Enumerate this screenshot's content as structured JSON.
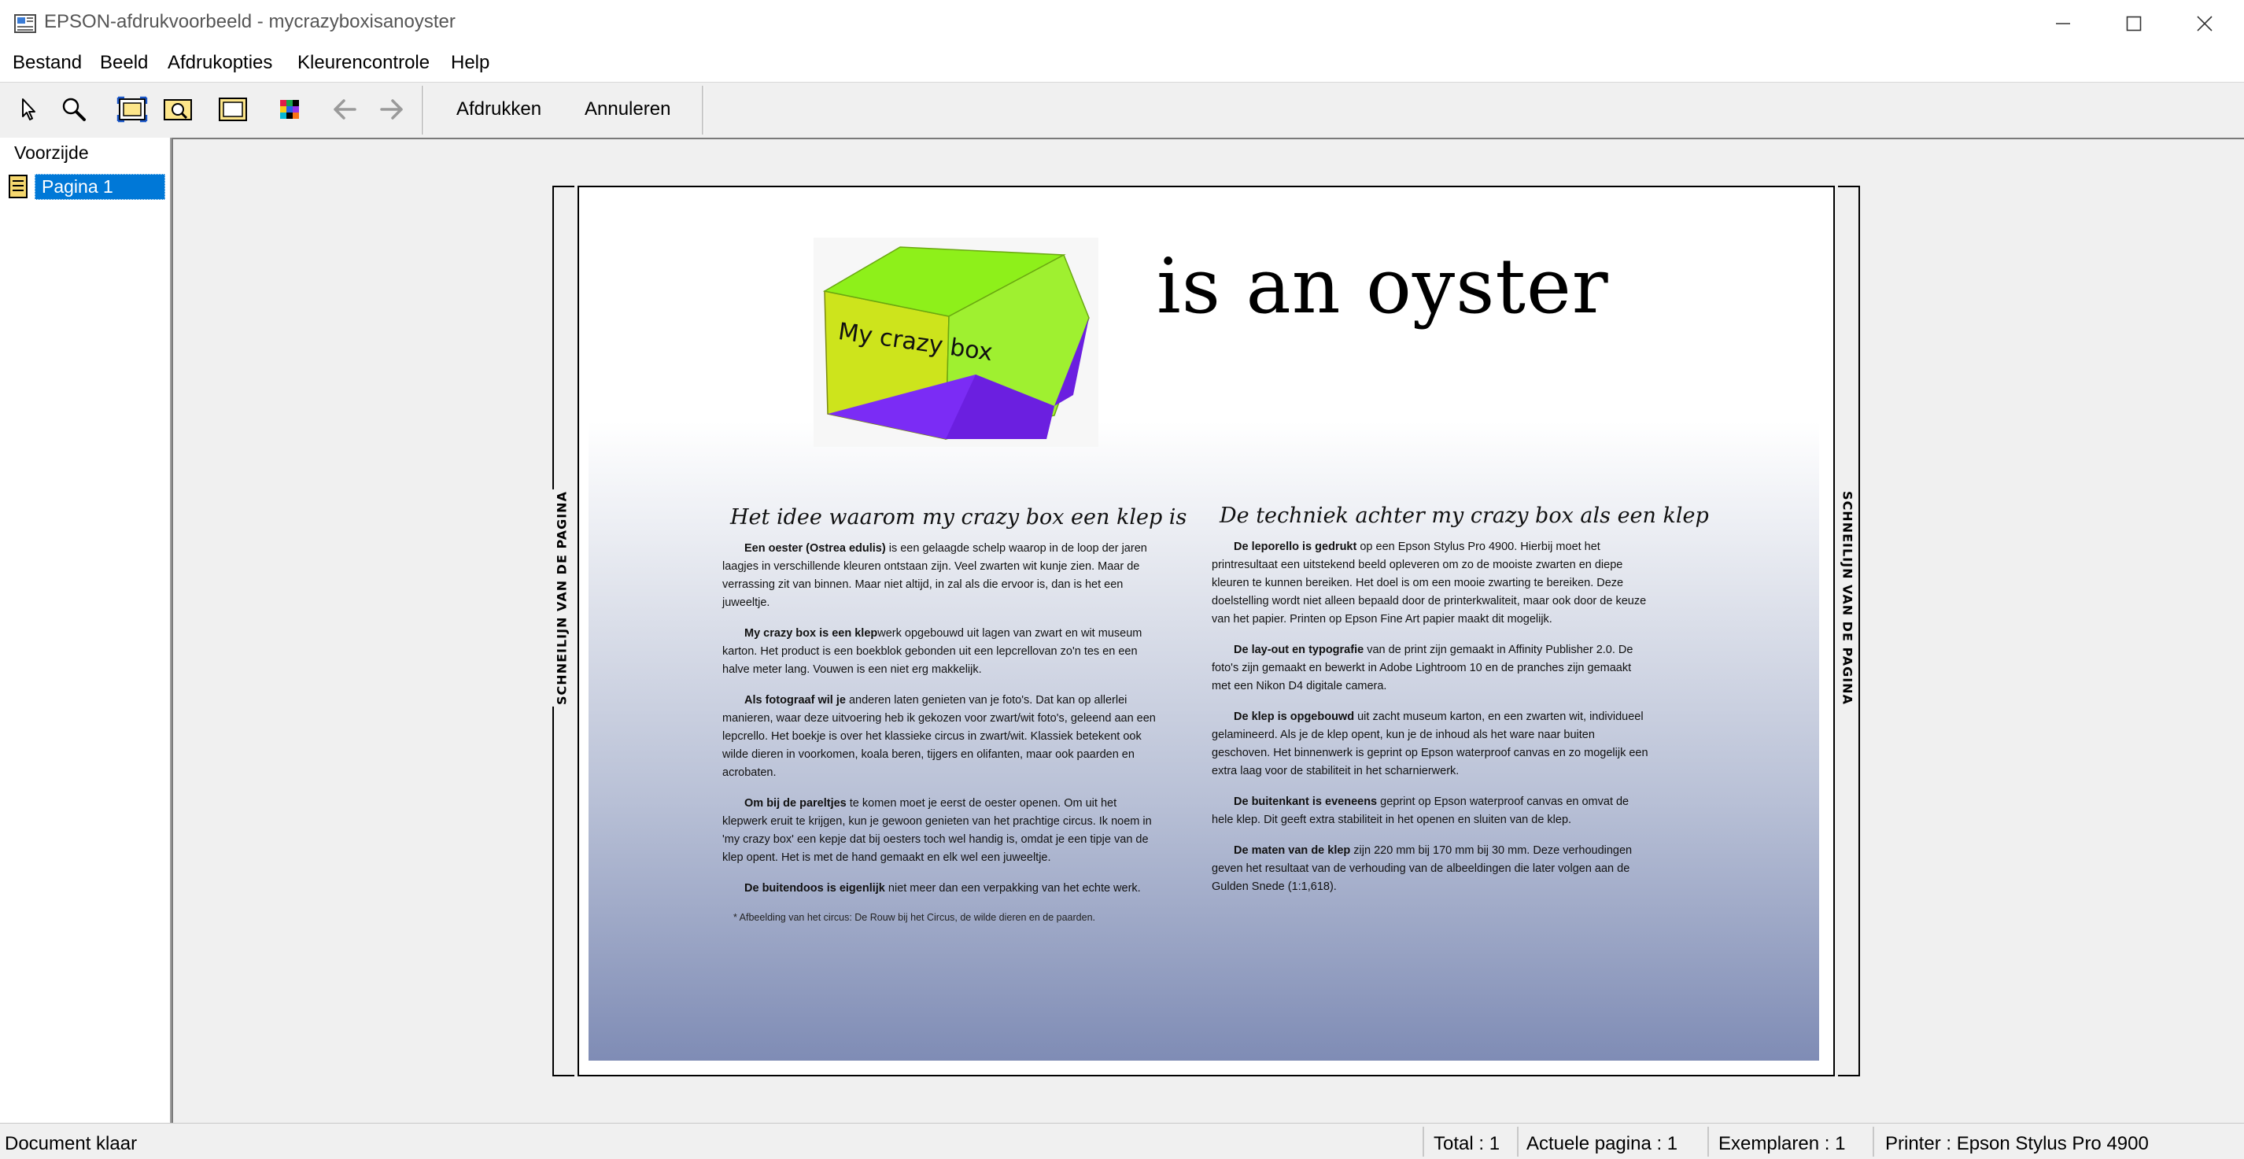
{
  "window": {
    "title": "EPSON-afdrukvoorbeeld - mycrazyboxisanoyster"
  },
  "menu": [
    "Bestand",
    "Beeld",
    "Afdrukopties",
    "Kleurencontrole",
    "Help"
  ],
  "toolbar": {
    "print_label": "Afdrukken",
    "cancel_label": "Annuleren"
  },
  "sidebar": {
    "heading": "Voorzijde",
    "items": [
      {
        "label": "Pagina 1"
      }
    ]
  },
  "preview": {
    "cut_line_label": "SCHNEILIJN VAN DE PAGINA",
    "logo_text": "My crazy box",
    "headline": "is an oyster",
    "left_column": {
      "heading": "Het idee waarom my crazy box een klep is",
      "paragraphs": [
        {
          "lead": "Een oester (Ostrea edulis)",
          "text": " is een gelaagde schelp waarop in de loop der jaren laagjes in verschillende kleuren ontstaan zijn. Veel zwarten wit kunje zien. Maar de verrassing zit van binnen. Maar niet altijd, in zal als die ervoor is, dan is het een juweeltje."
        },
        {
          "lead": "My crazy box is een klep",
          "text": "werk opgebouwd uit lagen van zwart en wit museum karton. Het product is een boekblok gebonden uit een lepcrellovan zo'n tes en een halve meter lang. Vouwen is een niet erg makkelijk."
        },
        {
          "lead": "Als fotograaf wil je",
          "text": " anderen laten genieten van je foto's. Dat kan op allerlei manieren, waar deze uitvoering heb ik gekozen voor zwart/wit foto's, geleend aan een lepcrello. Het boekje is over het klassieke circus in zwart/wit. Klassiek betekent ook wilde dieren in voorkomen, koala beren, tijgers en olifanten, maar ook paarden en acrobaten."
        },
        {
          "lead": "Om bij de pareltjes",
          "text": " te komen moet je eerst de oester openen. Om uit het klepwerk eruit te krijgen, kun je gewoon genieten van het prachtige circus. Ik noem in 'my crazy box' een kepje dat bij oesters toch wel handig is, omdat je een tipje van de klep opent. Het is met de hand gemaakt en elk wel een juweeltje."
        },
        {
          "lead": "De buitendoos is eigenlijk",
          "text": " niet meer dan een verpakking van het echte werk."
        }
      ],
      "footnote": "* Afbeelding van het circus: De Rouw bij het Circus, de wilde dieren en de paarden."
    },
    "right_column": {
      "heading": "De techniek achter my crazy box als een klep",
      "paragraphs": [
        {
          "lead": "De leporello is gedrukt",
          "text": " op een Epson Stylus Pro 4900. Hierbij moet het printresultaat een uitstekend beeld opleveren om zo de mooiste zwarten en diepe kleuren te kunnen bereiken. Het doel is om een mooie zwarting te bereiken. Deze doelstelling wordt niet alleen bepaald door de printerkwaliteit, maar ook door de keuze van het papier. Printen op Epson Fine Art papier maakt dit mogelijk."
        },
        {
          "lead": "De lay-out en typografie",
          "text": " van de print zijn gemaakt in Affinity Publisher 2.0. De foto's zijn gemaakt en bewerkt in Adobe Lightroom 10 en de pranches zijn gemaakt met een Nikon D4 digitale camera."
        },
        {
          "lead": "De klep is opgebouwd",
          "text": " uit zacht museum karton, en een zwarten wit, individueel gelamineerd. Als je de klep opent, kun je de inhoud als het ware naar buiten geschoven. Het binnenwerk is geprint op Epson waterproof canvas en zo mogelijk een extra laag voor de stabiliteit in het scharnierwerk."
        },
        {
          "lead": "De buitenkant is eveneens",
          "text": " geprint op Epson waterproof canvas en omvat de hele klep. Dit geeft extra stabiliteit in het openen en sluiten van de klep."
        },
        {
          "lead": "De maten van de klep",
          "text": " zijn 220 mm bij 170 mm bij 30 mm. Deze verhoudingen geven het resultaat van de verhouding van de albeeldingen die later volgen aan de Gulden Snede (1:1,618)."
        }
      ]
    }
  },
  "status": {
    "message": "Document klaar",
    "total": "Total : 1",
    "current_page": "Actuele pagina : 1",
    "copies": "Exemplaren : 1",
    "printer": "Printer : Epson Stylus Pro 4900"
  },
  "colors": {
    "selection": "#0078d7",
    "box_green": "#8ef01a",
    "box_yellow": "#cde41c",
    "box_purple": "#7b2cf5",
    "gradient_bottom": "#7f8cb5"
  }
}
